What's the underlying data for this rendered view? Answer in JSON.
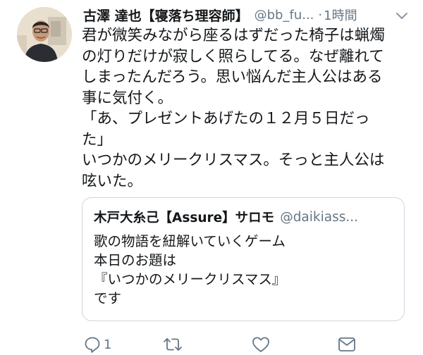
{
  "tweet": {
    "display_name": "古澤 達也【寝落ち理容師】",
    "handle": "@bb_fu...",
    "separator": "·",
    "time": "1時間",
    "text": "君が微笑みながら座るはずだった椅子は蝋燭\nの灯りだけが寂しく照らしてる。なぜ離れて\nしまったんだろう。思い悩んだ主人公はある\n事に気付く。\n「あ、プレゼントあげたの１２月５日だっ\nた」\nいつかのメリークリスマス。そっと主人公は\n呟いた。"
  },
  "quoted": {
    "display_name": "木戸大糸己【Assure】サロモ",
    "handle": "@daikiass...",
    "text": "歌の物語を紐解いていくゲーム\n本日のお題は\n『いつかのメリークリスマス』\nです"
  },
  "actions": {
    "reply_count": "1",
    "icons": [
      "reply-icon",
      "retweet-icon",
      "like-icon",
      "message-icon"
    ]
  },
  "colors": {
    "text": "#14171a",
    "secondary": "#657786",
    "border": "#ccd6dd"
  }
}
